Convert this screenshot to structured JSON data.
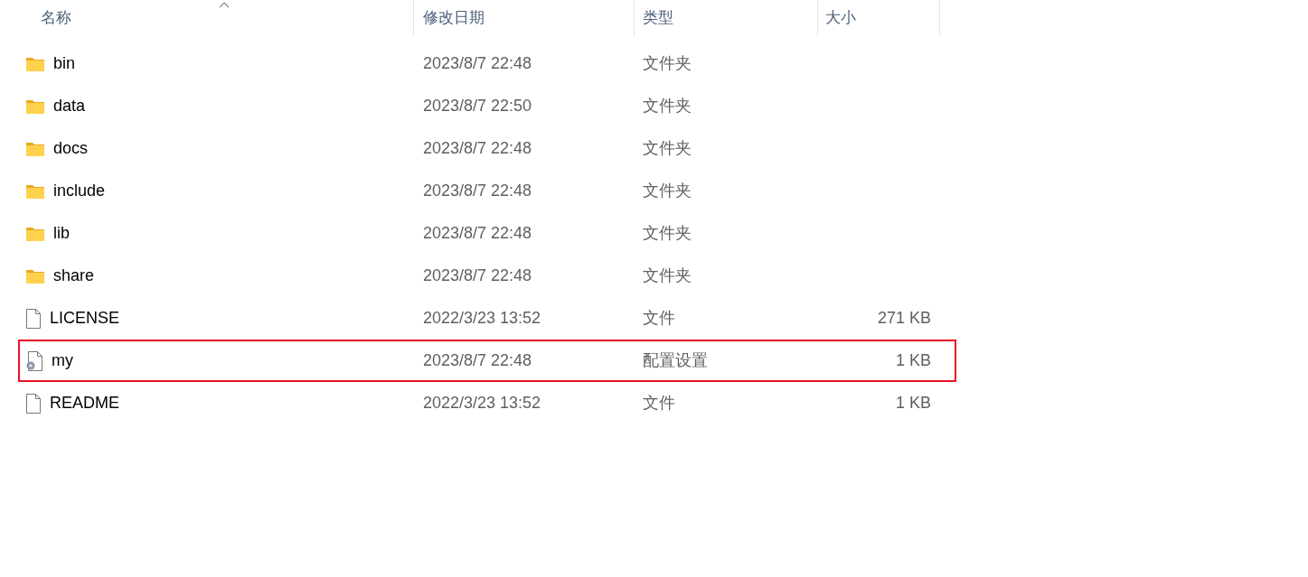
{
  "columns": [
    {
      "label": "名称",
      "sorted": true
    },
    {
      "label": "修改日期",
      "sorted": false
    },
    {
      "label": "类型",
      "sorted": false
    },
    {
      "label": "大小",
      "sorted": false
    }
  ],
  "rows": [
    {
      "kind": "folder",
      "name": "bin",
      "date": "2023/8/7 22:48",
      "type": "文件夹",
      "highlighted": false
    },
    {
      "kind": "folder",
      "name": "data",
      "date": "2023/8/7 22:50",
      "type": "文件夹",
      "highlighted": false
    },
    {
      "kind": "folder",
      "name": "docs",
      "date": "2023/8/7 22:48",
      "type": "文件夹",
      "highlighted": false
    },
    {
      "kind": "folder",
      "name": "include",
      "date": "2023/8/7 22:48",
      "type": "文件夹",
      "highlighted": false
    },
    {
      "kind": "folder",
      "name": "lib",
      "date": "2023/8/7 22:48",
      "type": "文件夹",
      "highlighted": false
    },
    {
      "kind": "folder",
      "name": "share",
      "date": "2023/8/7 22:48",
      "type": "文件夹",
      "highlighted": false
    },
    {
      "kind": "file",
      "name": "LICENSE",
      "date": "2022/3/23 13:52",
      "type": "文件",
      "size": "271 KB",
      "highlighted": false
    },
    {
      "kind": "config",
      "name": "my",
      "date": "2023/8/7 22:48",
      "type": "配置设置",
      "size": "1 KB",
      "highlighted": true
    },
    {
      "kind": "file",
      "name": "README",
      "date": "2022/3/23 13:52",
      "type": "文件",
      "size": "1 KB",
      "highlighted": false
    }
  ]
}
